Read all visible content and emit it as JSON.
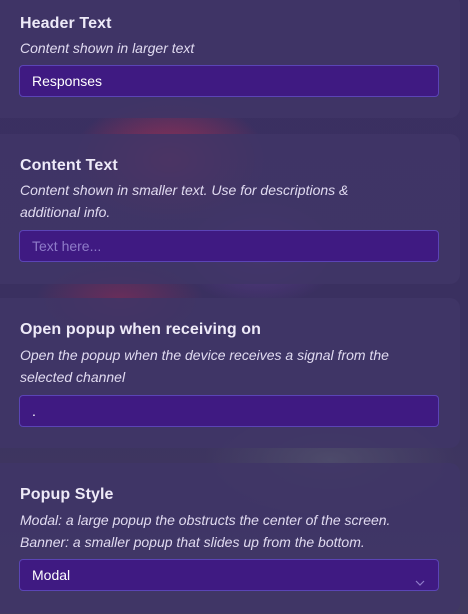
{
  "header_text": {
    "title": "Header Text",
    "description": "Content shown in larger text",
    "value": "Responses"
  },
  "content_text": {
    "title": "Content Text",
    "description": "Content shown in smaller text. Use for descriptions & additional info.",
    "value": "",
    "placeholder": "Text here..."
  },
  "open_popup": {
    "title": "Open popup when receiving on",
    "description": "Open the popup when the device receives a signal from the selected channel",
    "value": "."
  },
  "popup_style": {
    "title": "Popup Style",
    "description_line1": "Modal: a large popup the obstructs the center of the screen.",
    "description_line2": "Banner: a smaller popup that slides up from the bottom.",
    "selected": "Modal",
    "icon": "chevron-down-icon"
  },
  "colors": {
    "card_bg": "#403666",
    "field_bg": "#3f1a82",
    "field_border": "#5b44b6",
    "placeholder": "#8f7cc9"
  }
}
